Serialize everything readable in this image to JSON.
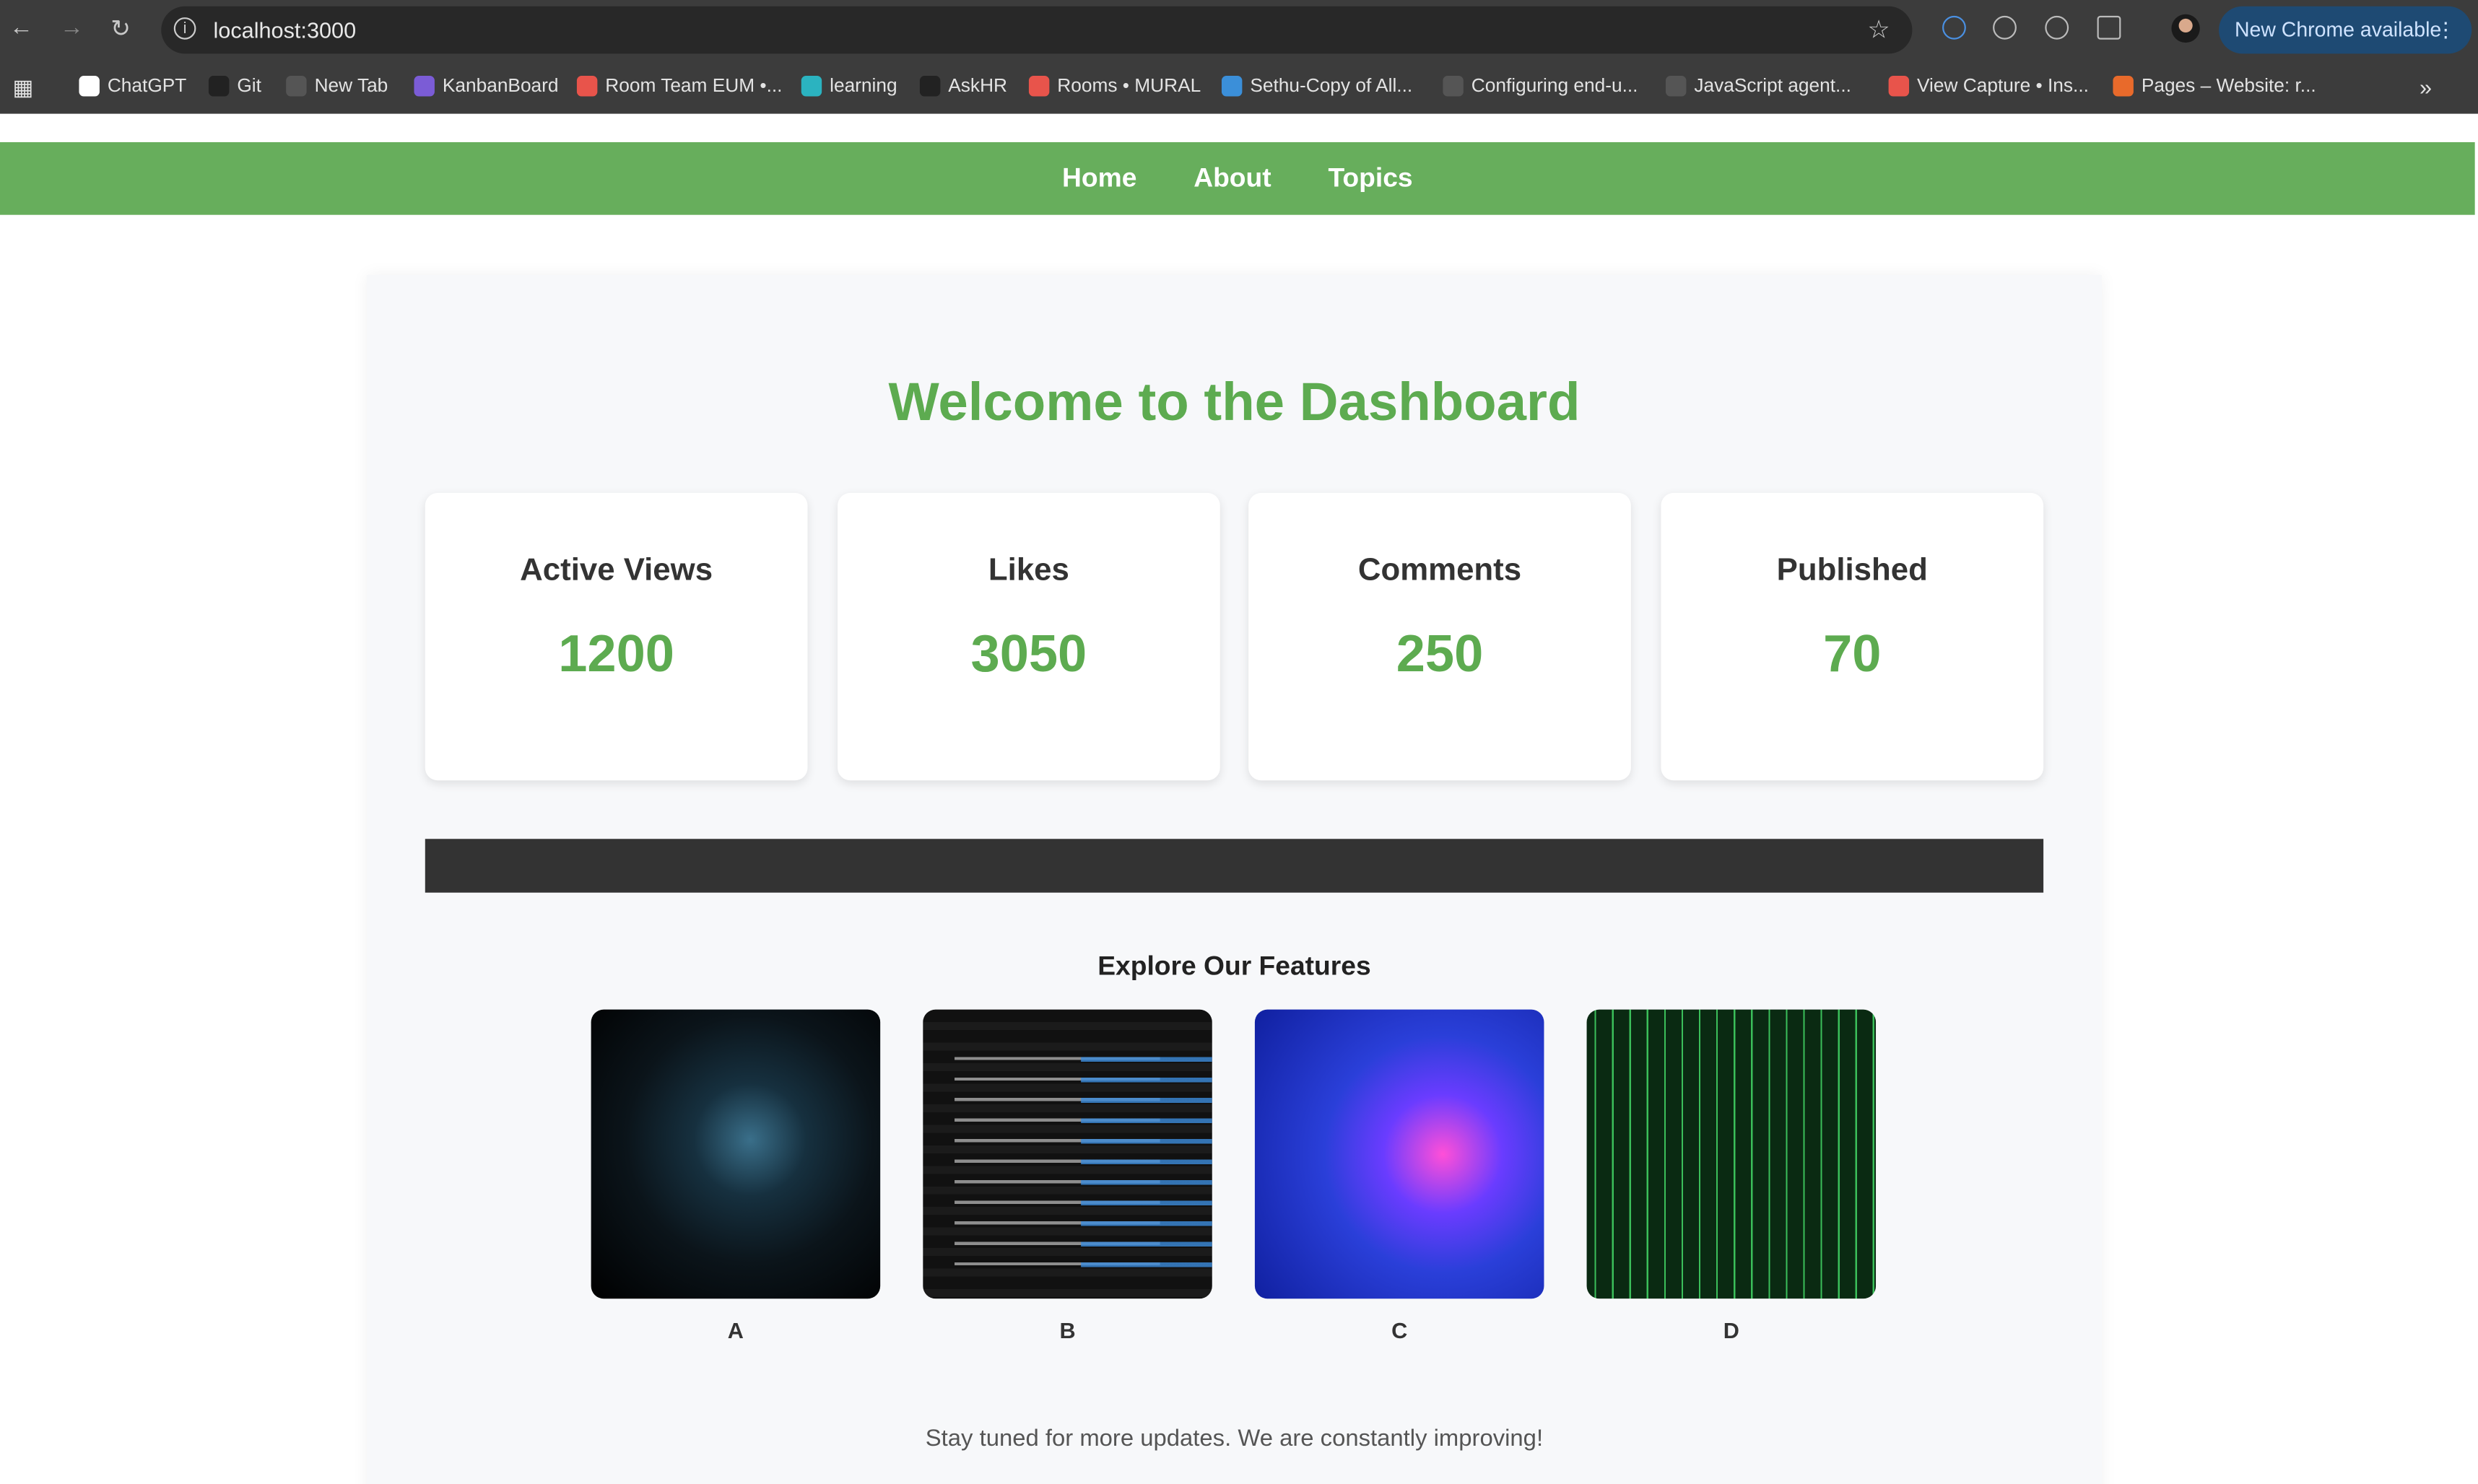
{
  "browser": {
    "url": "localhost:3000",
    "new_chrome": "New Chrome available",
    "bookmarks": [
      {
        "label": "ChatGPT",
        "color": "#ffffff"
      },
      {
        "label": "Git",
        "color": "#222222"
      },
      {
        "label": "New Tab",
        "color": "#555555"
      },
      {
        "label": "KanbanBoard",
        "color": "#7b5cd6"
      },
      {
        "label": "Room Team EUM •...",
        "color": "#e8544b"
      },
      {
        "label": "learning",
        "color": "#2bb3c0"
      },
      {
        "label": "AskHR",
        "color": "#222222"
      },
      {
        "label": "Rooms • MURAL",
        "color": "#e8544b"
      },
      {
        "label": "Sethu-Copy of All...",
        "color": "#3b8fd9"
      },
      {
        "label": "Configuring end-u...",
        "color": "#555555"
      },
      {
        "label": "JavaScript agent...",
        "color": "#555555"
      },
      {
        "label": "View Capture • Ins...",
        "color": "#e8544b"
      },
      {
        "label": "Pages – Website: r...",
        "color": "#e86a2b"
      }
    ],
    "overflow": "»"
  },
  "nav": {
    "items": [
      "Home",
      "About",
      "Topics"
    ]
  },
  "main": {
    "title": "Welcome to the Dashboard",
    "stats": [
      {
        "label": "Active Views",
        "value": "1200"
      },
      {
        "label": "Likes",
        "value": "3050"
      },
      {
        "label": "Comments",
        "value": "250"
      },
      {
        "label": "Published",
        "value": "70"
      }
    ],
    "features_title": "Explore Our Features",
    "features": [
      {
        "label": "A"
      },
      {
        "label": "B"
      },
      {
        "label": "C"
      },
      {
        "label": "D"
      }
    ],
    "footer": "Stay tuned for more updates. We are constantly improving!"
  },
  "colors": {
    "accent": "#5dab50",
    "navbar": "#67ae5c",
    "darkbar": "#333333"
  }
}
